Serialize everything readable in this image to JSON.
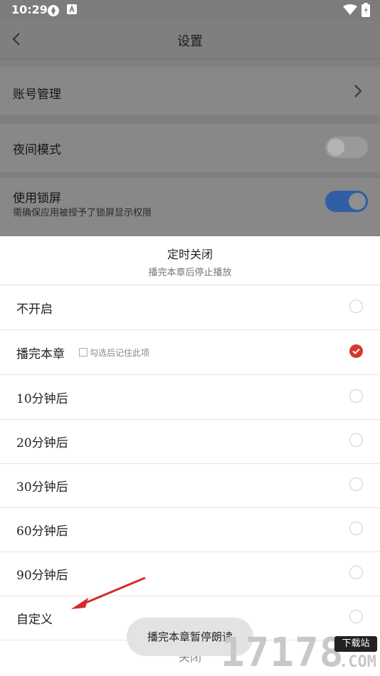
{
  "status_bar": {
    "time": "10:29",
    "icons": [
      "app-icon",
      "a-badge-icon",
      "wifi-icon",
      "battery-icon"
    ]
  },
  "settings": {
    "title": "设置",
    "account": {
      "label": "账号管理"
    },
    "night_mode": {
      "label": "夜间模式",
      "enabled": false
    },
    "lock_screen": {
      "label": "使用锁屏",
      "sub": "需确保应用被授予了锁屏显示权限",
      "enabled": true
    }
  },
  "sheet": {
    "title": "定时关闭",
    "subtitle": "播完本章后停止播放",
    "options": [
      {
        "label": "不开启",
        "selected": false
      },
      {
        "label": "播完本章",
        "selected": true
      },
      {
        "label": "10分钟后",
        "selected": false
      },
      {
        "label": "20分钟后",
        "selected": false
      },
      {
        "label": "30分钟后",
        "selected": false
      },
      {
        "label": "60分钟后",
        "selected": false
      },
      {
        "label": "90分钟后",
        "selected": false
      },
      {
        "label": "自定义",
        "selected": false
      }
    ],
    "remember_label": "勾选后记住此项",
    "close": "关闭"
  },
  "toast": "播完本章暂停朗读",
  "watermark": {
    "tag": "下载站",
    "number": "17178",
    "domain": ".COM"
  },
  "colors": {
    "accent": "#d6372f",
    "toggle_on": "#2f5ea7",
    "overlay": "#7f7f7f"
  }
}
